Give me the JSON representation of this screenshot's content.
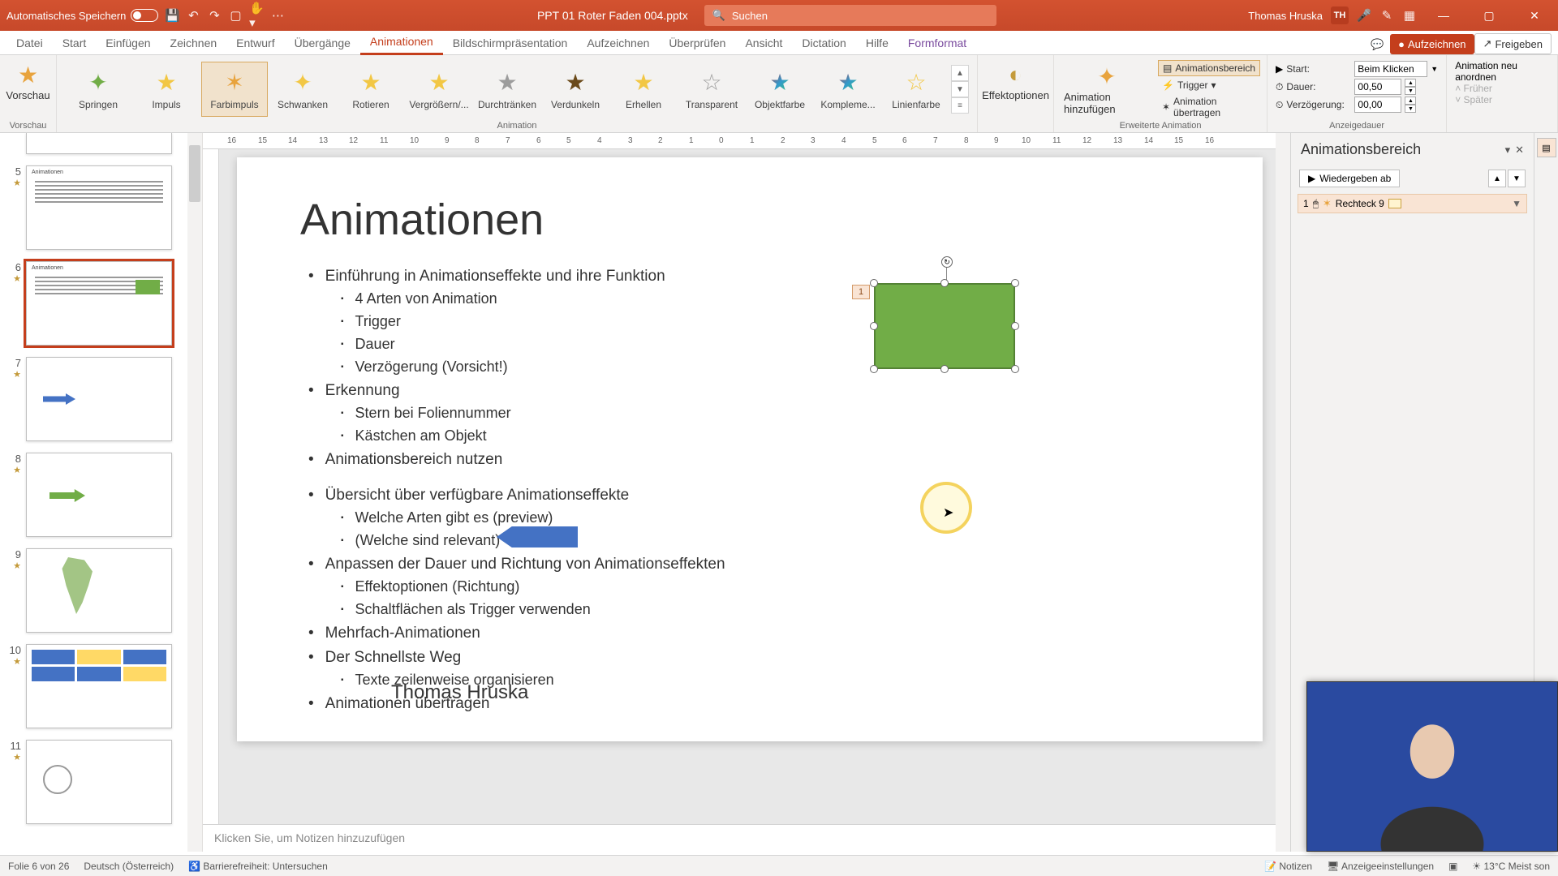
{
  "titlebar": {
    "autosave": "Automatisches Speichern",
    "filename": "PPT 01 Roter Faden 004.pptx",
    "search_placeholder": "Suchen",
    "user": "Thomas Hruska",
    "initials": "TH"
  },
  "tabs": {
    "datei": "Datei",
    "start": "Start",
    "einfuegen": "Einfügen",
    "zeichnen": "Zeichnen",
    "entwurf": "Entwurf",
    "uebergaenge": "Übergänge",
    "animationen": "Animationen",
    "bildschirm": "Bildschirmpräsentation",
    "aufzeichnen": "Aufzeichnen",
    "ueberpruefen": "Überprüfen",
    "ansicht": "Ansicht",
    "dictation": "Dictation",
    "hilfe": "Hilfe",
    "formformat": "Formformat",
    "aufzeichnen_btn": "Aufzeichnen",
    "freigeben": "Freigeben"
  },
  "ribbon": {
    "vorschau": "Vorschau",
    "vorschau_group": "Vorschau",
    "animation_group": "Animation",
    "erweiterte_group": "Erweiterte Animation",
    "anzeigedauer_group": "Anzeigedauer",
    "effekte": {
      "springen": "Springen",
      "impuls": "Impuls",
      "farbimpuls": "Farbimpuls",
      "schwanken": "Schwanken",
      "rotieren": "Rotieren",
      "vergroessern": "Vergrößern/...",
      "durchtraenken": "Durchtränken",
      "verdunkeln": "Verdunkeln",
      "erhellen": "Erhellen",
      "transparent": "Transparent",
      "objektfarbe": "Objektfarbe",
      "kompleme": "Kompleme...",
      "linienfarbe": "Linienfarbe"
    },
    "effektoptionen": "Effektoptionen",
    "animation_hinzufuegen": "Animation hinzufügen",
    "animationsbereich": "Animationsbereich",
    "trigger": "Trigger",
    "animation_uebertragen": "Animation übertragen",
    "start": "Start:",
    "start_value": "Beim Klicken",
    "dauer": "Dauer:",
    "dauer_value": "00,50",
    "verzoegerung": "Verzögerung:",
    "verzoegerung_value": "00,00",
    "neu_anordnen": "Animation neu anordnen",
    "frueher": "Früher",
    "spaeter": "Später"
  },
  "thumbs": {
    "5": "5",
    "6": "6",
    "7": "7",
    "8": "8",
    "9": "9",
    "10": "10",
    "11": "11"
  },
  "slide": {
    "title": "Animationen",
    "bullets": [
      "Einführung in Animationseffekte und ihre Funktion",
      "Erkennung",
      "Animationsbereich nutzen",
      "Übersicht über verfügbare Animationseffekte",
      "Anpassen der Dauer und Richtung von Animationseffekten",
      "Mehrfach-Animationen",
      "Der Schnellste Weg",
      "Animationen übertragen"
    ],
    "sub1": [
      "4 Arten von Animation",
      "Trigger",
      "Dauer",
      "Verzögerung (Vorsicht!)"
    ],
    "sub2": [
      "Stern bei Foliennummer",
      "Kästchen am Objekt"
    ],
    "sub4": [
      "Welche Arten gibt es (preview)",
      "(Welche sind relevant)"
    ],
    "sub5": [
      "Effektoptionen (Richtung)",
      "Schaltflächen als Trigger verwenden"
    ],
    "sub7": [
      "Texte zeilenweise organisieren"
    ],
    "author": "Thomas Hruska",
    "anim_tag": "1"
  },
  "notes": {
    "placeholder": "Klicken Sie, um Notizen hinzuzufügen"
  },
  "anim_pane": {
    "title": "Animationsbereich",
    "play": "Wiedergeben ab",
    "entry_num": "1",
    "entry_label": "Rechteck 9"
  },
  "statusbar": {
    "slide": "Folie 6 von 26",
    "lang": "Deutsch (Österreich)",
    "access": "Barrierefreiheit: Untersuchen",
    "notizen": "Notizen",
    "anzeige": "Anzeigeeinstellungen",
    "weather": "13°C  Meist son"
  }
}
